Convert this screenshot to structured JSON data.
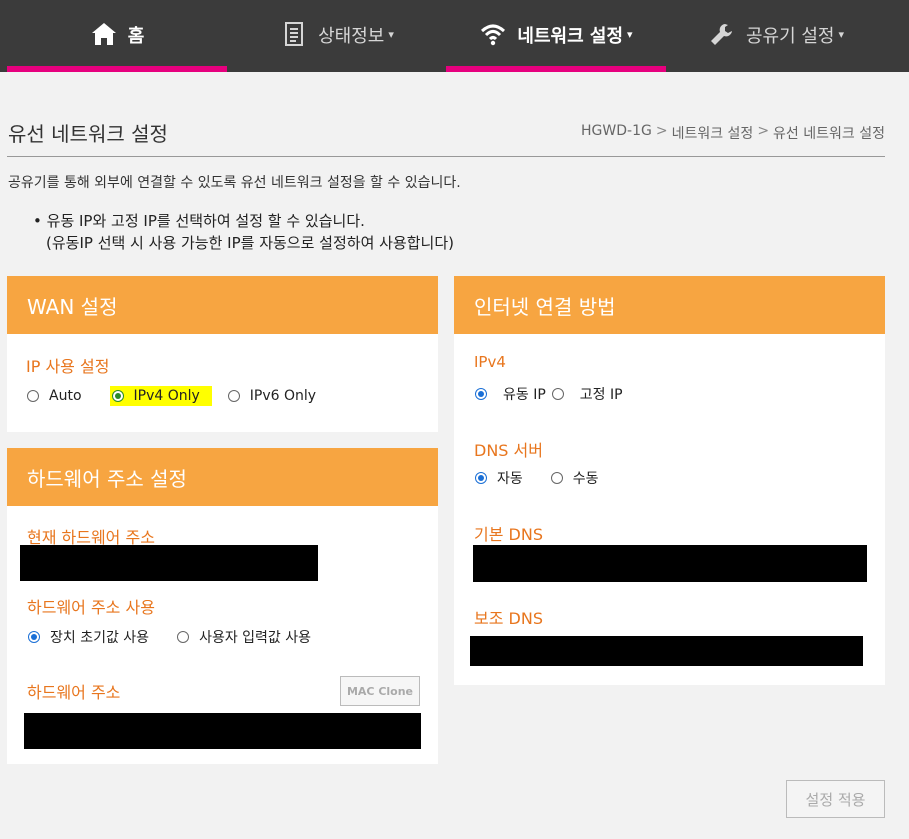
{
  "nav": {
    "home": "홈",
    "status": "상태정보",
    "network": "네트워크 설정",
    "router": "공유기 설정",
    "caret": "▾"
  },
  "page": {
    "title": "유선 네트워크 설정",
    "breadcrumb": [
      "HGWD-1G",
      "네트워크 설정",
      "유선 네트워크 설정"
    ],
    "breadcrumb_sep": ">",
    "description": "공유기를 통해 외부에 연결할 수 있도록 유선 네트워크 설정을 할 수 있습니다.",
    "note_line1": "유동 IP와 고정 IP를 선택하여 설정 할 수 있습니다.",
    "note_line2": "(유동IP 선택 시 사용 가능한 IP를 자동으로 설정하여 사용합니다)",
    "bullet": "•"
  },
  "wan": {
    "title": "WAN 설정",
    "ip_label": "IP 사용 설정",
    "options": [
      "Auto",
      "IPv4 Only",
      "IPv6 Only"
    ],
    "selected": "IPv4 Only"
  },
  "hw": {
    "title": "하드웨어 주소 설정",
    "current_label": "현재 하드웨어 주소",
    "use_label": "하드웨어 주소 사용",
    "options": [
      "장치 초기값 사용",
      "사용자 입력값 사용"
    ],
    "selected": "장치 초기값 사용",
    "addr_label": "하드웨어 주소",
    "mac_clone": "MAC Clone"
  },
  "internet": {
    "title": "인터넷 연결 방법",
    "ipv4_label": "IPv4",
    "ipv4_options": [
      "유동 IP",
      "고정 IP"
    ],
    "ipv4_selected": "유동 IP",
    "dns_label": "DNS 서버",
    "dns_options": [
      "자동",
      "수동"
    ],
    "dns_selected": "자동",
    "primary_dns_label": "기본 DNS",
    "secondary_dns_label": "보조 DNS"
  },
  "apply_label": "설정 적용",
  "colors": {
    "nav_bg": "#3b3b3b",
    "accent_pink": "#e6007e",
    "panel_orange": "#f7a541",
    "label_orange": "#e8761e",
    "highlight": "#ffff00"
  }
}
